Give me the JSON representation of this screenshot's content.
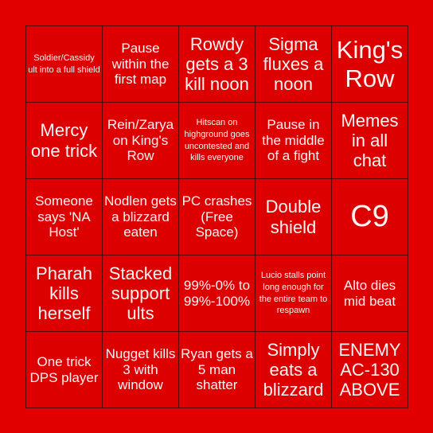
{
  "cells": [
    {
      "text": "Soldier/Cassidy ult into a full shield",
      "size": "s"
    },
    {
      "text": "Pause within the first map",
      "size": "m"
    },
    {
      "text": "Rowdy gets a 3 kill noon",
      "size": "l"
    },
    {
      "text": "Sigma fluxes a noon",
      "size": "l"
    },
    {
      "text": "King's Row",
      "size": "xl"
    },
    {
      "text": "Mercy one trick",
      "size": "l"
    },
    {
      "text": "Rein/Zarya on King's Row",
      "size": "m"
    },
    {
      "text": "Hitscan on highground goes uncontested and kills everyone",
      "size": "s"
    },
    {
      "text": "Pause in the middle of a fight",
      "size": "m"
    },
    {
      "text": "Memes in all chat",
      "size": "l"
    },
    {
      "text": "Someone says 'NA Host'",
      "size": "m"
    },
    {
      "text": "Nodlen gets a blizzard eaten",
      "size": "m"
    },
    {
      "text": "PC crashes (Free Space)",
      "size": "m"
    },
    {
      "text": "Double shield",
      "size": "l"
    },
    {
      "text": "C9",
      "size": "xxl"
    },
    {
      "text": "Pharah kills herself",
      "size": "l"
    },
    {
      "text": "Stacked support ults",
      "size": "l"
    },
    {
      "text": "99%-0% to 99%-100%",
      "size": "m"
    },
    {
      "text": "Lucio stalls point long enough for the entire team to respawn",
      "size": "s"
    },
    {
      "text": "Alto dies mid beat",
      "size": "m"
    },
    {
      "text": "One trick DPS player",
      "size": "m"
    },
    {
      "text": "Nugget kills 3 with window",
      "size": "m"
    },
    {
      "text": "Ryan gets a 5 man shatter",
      "size": "m"
    },
    {
      "text": "Simply eats a blizzard",
      "size": "l"
    },
    {
      "text": "ENEMY AC-130 ABOVE",
      "size": "l"
    }
  ],
  "colors": {
    "background": "#e00000",
    "cell": "#dc0000",
    "border": "#5a0000",
    "text": "#fff2f2"
  }
}
